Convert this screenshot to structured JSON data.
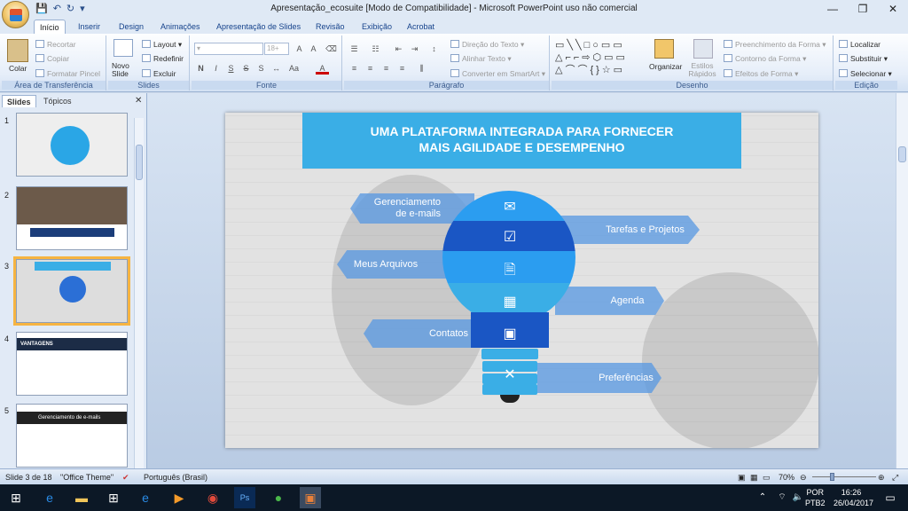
{
  "window": {
    "title": "Apresentação_ecosuite [Modo de Compatibilidade] - Microsoft PowerPoint uso não comercial"
  },
  "ribbon_tabs": [
    "Início",
    "Inserir",
    "Design",
    "Animações",
    "Apresentação de Slides",
    "Revisão",
    "Exibição",
    "Acrobat"
  ],
  "ribbon": {
    "clipboard": {
      "paste": "Colar",
      "cut": "Recortar",
      "copy": "Copiar",
      "format_painter": "Formatar Pincel",
      "label": "Área de Transferência"
    },
    "slides": {
      "new_slide": "Novo Slide",
      "layout": "Layout",
      "reset": "Redefinir",
      "delete": "Excluir",
      "label": "Slides"
    },
    "font": {
      "label": "Fonte",
      "size": "18+"
    },
    "paragraph": {
      "text_direction": "Direção do Texto",
      "align_text": "Alinhar Texto",
      "smartart": "Converter em SmartArt",
      "label": "Parágrafo"
    },
    "drawing": {
      "arrange": "Organizar",
      "quick_styles": "Estilos Rápidos",
      "shape_fill": "Preenchimento da Forma",
      "shape_outline": "Contorno da Forma",
      "shape_effects": "Efeitos de Forma",
      "label": "Desenho"
    },
    "editing": {
      "find": "Localizar",
      "replace": "Substituir",
      "select": "Selecionar",
      "label": "Edição"
    }
  },
  "panel": {
    "tab_slides": "Slides",
    "tab_outline": "Tópicos",
    "thumbs": [
      {
        "num": "1"
      },
      {
        "num": "2"
      },
      {
        "num": "3"
      },
      {
        "num": "4",
        "title": "VANTAGENS"
      },
      {
        "num": "5",
        "title": "Gerenciamento de e-mails"
      }
    ]
  },
  "slide": {
    "title_line1": "UMA PLATAFORMA INTEGRADA PARA FORNECER",
    "title_line2": "MAIS AGILIDADE E DESEMPENHO",
    "labels": {
      "emails": "Gerenciamento de e-mails",
      "tasks": "Tarefas e Projetos",
      "files": "Meus Arquivos",
      "agenda": "Agenda",
      "contacts": "Contatos",
      "prefs": "Preferências"
    },
    "colors": {
      "accent": "#3aaee6",
      "bulb_light": "#2b9df0",
      "bulb_dark": "#1a56c4",
      "label_bg": "#5b9ae2"
    }
  },
  "status": {
    "slide_info": "Slide 3 de 18",
    "theme": "\"Office Theme\"",
    "language": "Português (Brasil)",
    "zoom": "70%"
  },
  "taskbar": {
    "lang1": "POR",
    "lang2": "PTB2",
    "time": "16:26",
    "date": "26/04/2017"
  }
}
